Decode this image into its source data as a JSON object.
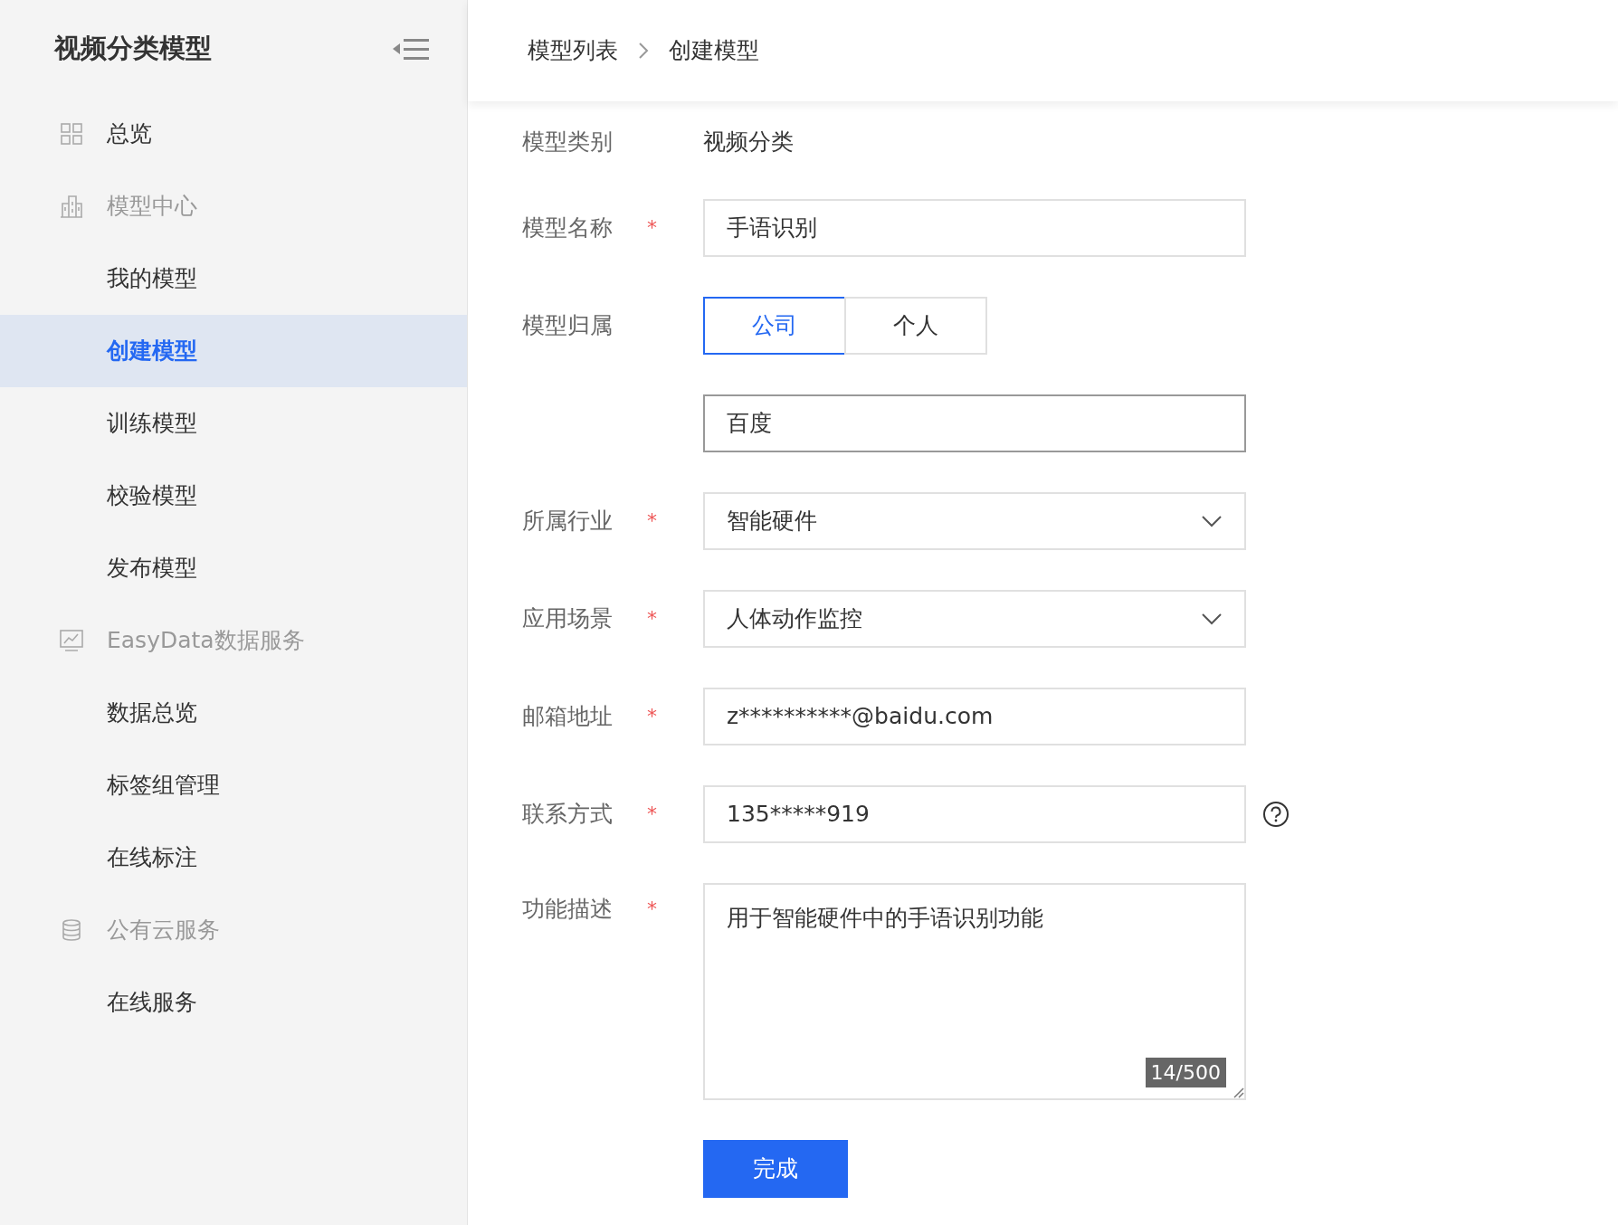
{
  "sidebar": {
    "title": "视频分类模型",
    "nav": [
      {
        "label": "总览",
        "kind": "page"
      },
      {
        "label": "模型中心",
        "kind": "group",
        "children": [
          {
            "label": "我的模型",
            "selected": false
          },
          {
            "label": "创建模型",
            "selected": true
          },
          {
            "label": "训练模型",
            "selected": false
          },
          {
            "label": "校验模型",
            "selected": false
          },
          {
            "label": "发布模型",
            "selected": false
          }
        ]
      },
      {
        "label": "EasyData数据服务",
        "kind": "group",
        "children": [
          {
            "label": "数据总览",
            "selected": false
          },
          {
            "label": "标签组管理",
            "selected": false
          },
          {
            "label": "在线标注",
            "selected": false
          }
        ]
      },
      {
        "label": "公有云服务",
        "kind": "group",
        "children": [
          {
            "label": "在线服务",
            "selected": false
          }
        ]
      }
    ]
  },
  "breadcrumb": [
    "模型列表",
    "创建模型"
  ],
  "form": {
    "rows": [
      {
        "kind": "static",
        "label": "模型类别",
        "value": "视频分类"
      },
      {
        "kind": "text",
        "label": "模型名称",
        "required_mark": "*",
        "value": "手语识别",
        "focused": false
      },
      {
        "kind": "segmented",
        "label": "模型归属",
        "options": [
          {
            "label": "公司",
            "selected": true
          },
          {
            "label": "个人",
            "selected": false
          }
        ]
      },
      {
        "kind": "text",
        "value": "百度",
        "focused": true
      },
      {
        "kind": "select",
        "label": "所属行业",
        "required_mark": "*",
        "value": "智能硬件"
      },
      {
        "kind": "select",
        "label": "应用场景",
        "required_mark": "*",
        "value": "人体动作监控"
      },
      {
        "kind": "text",
        "label": "邮箱地址",
        "required_mark": "*",
        "value": "z**********@baidu.com",
        "focused": false
      },
      {
        "kind": "text",
        "label": "联系方式",
        "required_mark": "*",
        "value": "135*****919",
        "focused": false,
        "help": true
      },
      {
        "kind": "textarea",
        "label": "功能描述",
        "required_mark": "*",
        "value": "用于智能硬件中的手语识别功能",
        "counter": "14/500"
      }
    ],
    "submit": "完成"
  }
}
